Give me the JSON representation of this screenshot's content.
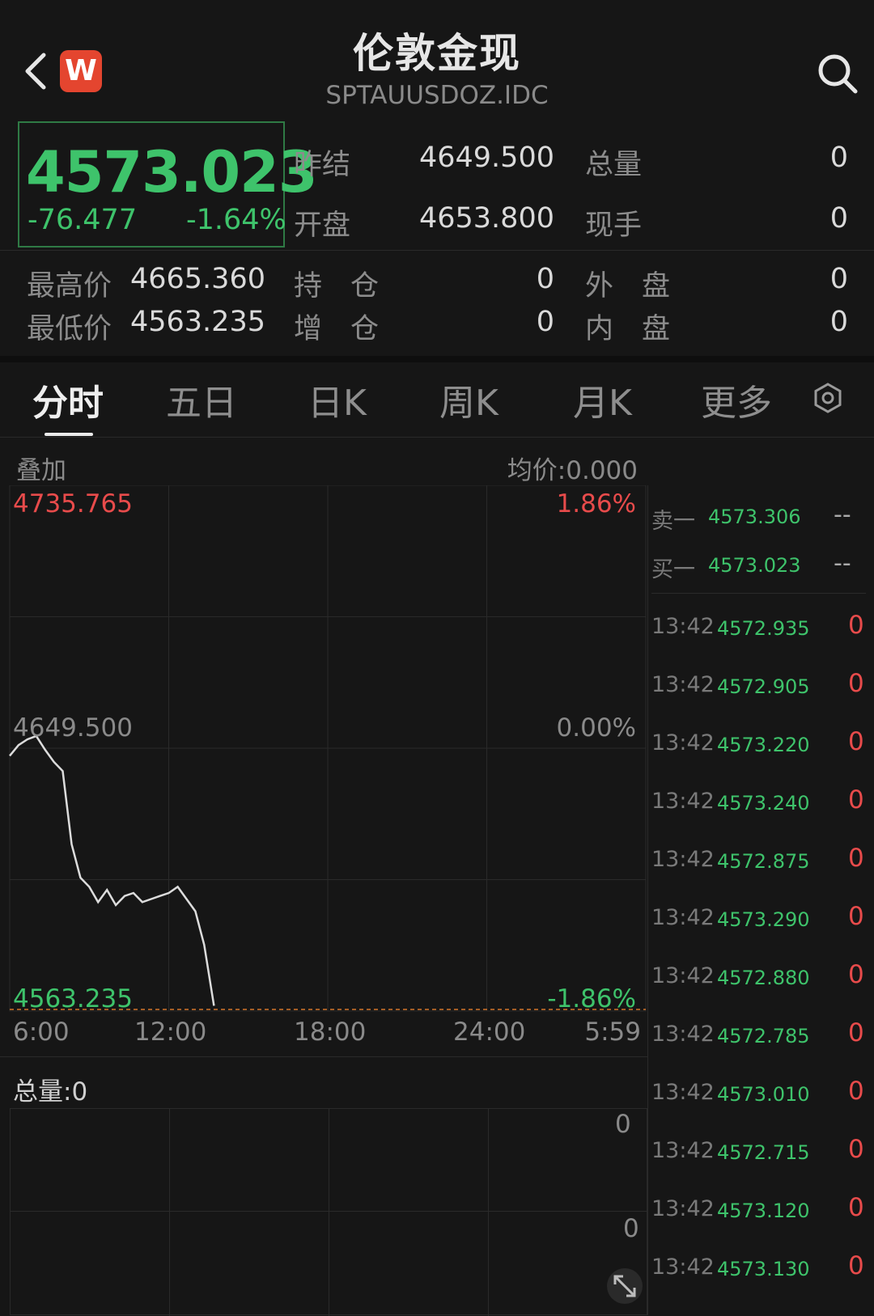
{
  "header": {
    "title": "伦敦金现",
    "code": "SPTAUUSDOZ.IDC",
    "logo_letter": "W"
  },
  "quote": {
    "price": "4573.023",
    "change": "-76.477",
    "change_pct": "-1.64%",
    "prev_settle_label": "昨结",
    "prev_settle": "4649.500",
    "open_label": "开盘",
    "open": "4653.800",
    "total_vol_label": "总量",
    "total_vol": "0",
    "cur_hand_label": "现手",
    "cur_hand": "0",
    "high_label": "最高价",
    "high": "4665.360",
    "low_label": "最低价",
    "low": "4563.235",
    "hold_label": "持　仓",
    "hold": "0",
    "add_label": "增　仓",
    "add": "0",
    "outer_label": "外　盘",
    "outer": "0",
    "inner_label": "内　盘",
    "inner": "0"
  },
  "tabs": [
    "分时",
    "五日",
    "日K",
    "周K",
    "月K",
    "更多"
  ],
  "chart": {
    "overlay_label": "叠加",
    "avg_label": "均价:0.000",
    "top_price": "4735.765",
    "top_pct": "1.86%",
    "mid_price": "4649.500",
    "mid_pct": "0.00%",
    "bot_price": "4563.235",
    "bot_pct": "-1.86%",
    "x_labels": [
      "6:00",
      "12:00",
      "18:00",
      "24:00",
      "5:59"
    ],
    "vol_label": "总量:0",
    "vol_tick_top": "0",
    "vol_tick_mid": "0"
  },
  "chart_data": {
    "type": "line",
    "title": "",
    "xlabel": "",
    "ylabel": "",
    "ylim": [
      4563.235,
      4735.765
    ],
    "reference": 4649.5,
    "x_ticks": [
      "6:00",
      "12:00",
      "18:00",
      "24:00",
      "5:59"
    ],
    "x": [
      "6:00",
      "6:20",
      "6:40",
      "7:00",
      "7:20",
      "7:40",
      "8:00",
      "8:20",
      "8:40",
      "9:00",
      "9:20",
      "9:40",
      "10:00",
      "10:20",
      "10:40",
      "11:00",
      "11:20",
      "11:40",
      "12:00",
      "12:20",
      "12:40",
      "13:00",
      "13:20",
      "13:42"
    ],
    "series": [
      {
        "values": [
          4647.0,
          4650.5,
          4652.4,
          4653.5,
          4649.0,
          4645.0,
          4642.0,
          4618.0,
          4607.0,
          4604.0,
          4599.0,
          4603.0,
          4598.0,
          4601.0,
          4602.0,
          4599.0,
          4600.0,
          4601.0,
          4602.0,
          4604.0,
          4600.0,
          4596.0,
          4585.0,
          4565.0
        ]
      }
    ]
  },
  "orderbook": {
    "sell1_label": "卖一",
    "sell1_price": "4573.306",
    "sell1_vol": "--",
    "buy1_label": "买一",
    "buy1_price": "4573.023",
    "buy1_vol": "--"
  },
  "ticks": [
    {
      "time": "13:42",
      "price": "4572.935",
      "vol": "0"
    },
    {
      "time": "13:42",
      "price": "4572.905",
      "vol": "0"
    },
    {
      "time": "13:42",
      "price": "4573.220",
      "vol": "0"
    },
    {
      "time": "13:42",
      "price": "4573.240",
      "vol": "0"
    },
    {
      "time": "13:42",
      "price": "4572.875",
      "vol": "0"
    },
    {
      "time": "13:42",
      "price": "4573.290",
      "vol": "0"
    },
    {
      "time": "13:42",
      "price": "4572.880",
      "vol": "0"
    },
    {
      "time": "13:42",
      "price": "4572.785",
      "vol": "0"
    },
    {
      "time": "13:42",
      "price": "4573.010",
      "vol": "0"
    },
    {
      "time": "13:42",
      "price": "4572.715",
      "vol": "0"
    },
    {
      "time": "13:42",
      "price": "4573.120",
      "vol": "0"
    },
    {
      "time": "13:42",
      "price": "4573.130",
      "vol": "0"
    }
  ],
  "colors": {
    "background": "#161616",
    "up": "#e84b4b",
    "down": "#3ec36b",
    "line": "#dcdcdc",
    "dashed_low": "#d4752a",
    "logo": "#e4452f"
  }
}
